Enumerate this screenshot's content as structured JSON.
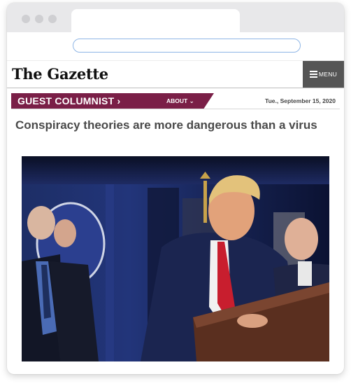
{
  "masthead": {
    "logo": "The Gazette",
    "menu_label": "MENU"
  },
  "section": {
    "title": "GUEST COLUMNIST",
    "title_chevron": "›",
    "about_label": "ABOUT",
    "about_chevron": "⌄",
    "date": "Tue., September 15, 2020"
  },
  "article": {
    "headline": "Conspiracy theories are more dangerous than a virus"
  },
  "colors": {
    "section_bar": "#7a1f47",
    "menu_button": "#555555",
    "address_border": "#8fb6e6"
  }
}
